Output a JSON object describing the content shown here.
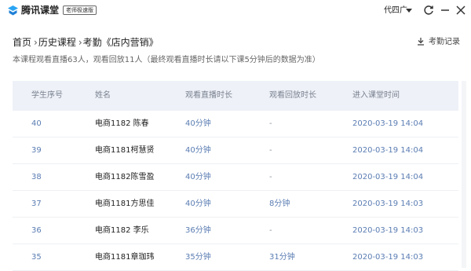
{
  "titlebar": {
    "app_name": "腾讯课堂",
    "edition": "老师极速版",
    "user": "代四广",
    "icons": [
      "logo-icon",
      "refresh-icon",
      "minimize-icon",
      "close-icon"
    ]
  },
  "breadcrumb": [
    "首页",
    "历史课程",
    "考勤《店内营销》"
  ],
  "breadcrumb_sep": "›",
  "record_label": "考勤记录",
  "summary": "本课程观看直播63人，观看回放11人（最终观看直播时长请以下课5分钟后的数据为准）",
  "table": {
    "headers": [
      "学生序号",
      "姓名",
      "观看直播时长",
      "观看回放时长",
      "进入课堂时间"
    ],
    "rows": [
      [
        "40",
        "电商1182 陈春",
        "40分钟",
        "-",
        "2020-03-19 14:04"
      ],
      [
        "39",
        "电商1181柯慧贤",
        "40分钟",
        "-",
        "2020-03-19 14:04"
      ],
      [
        "38",
        "电商1182陈雪盈",
        "40分钟",
        "-",
        "2020-03-19 14:04"
      ],
      [
        "37",
        "电商1181方思佳",
        "40分钟",
        "8分钟",
        "2020-03-19 14:03"
      ],
      [
        "36",
        "电商1182 李乐",
        "36分钟",
        "-",
        "2020-03-19 14:03"
      ],
      [
        "35",
        "电商1181章珈玮",
        "35分钟",
        "31分钟",
        "2020-03-19 14:03"
      ]
    ]
  },
  "colors": {
    "accent": "#5b7db3",
    "header_bg": "#eef1f7"
  }
}
